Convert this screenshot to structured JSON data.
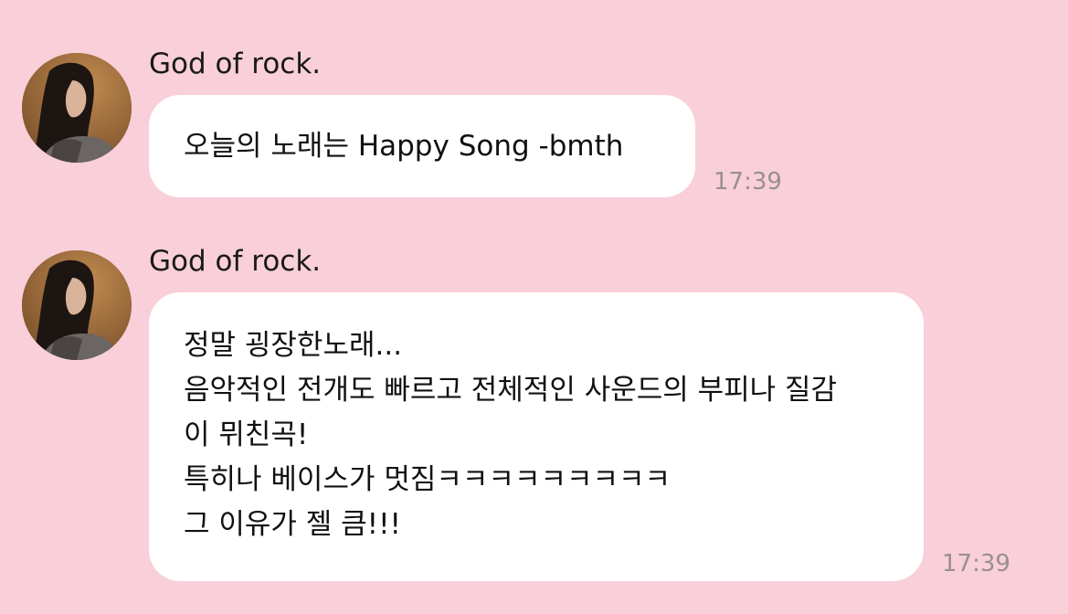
{
  "colors": {
    "background": "#f9cfd9",
    "bubble": "#ffffff",
    "text": "#111111",
    "timestamp": "#9a8f92"
  },
  "messages": [
    {
      "sender": "God of rock.",
      "avatar_icon": "profile-photo",
      "lines": [
        "오늘의 노래는 Happy Song -bmth"
      ],
      "time": "17:39"
    },
    {
      "sender": "God of rock.",
      "avatar_icon": "profile-photo",
      "lines": [
        "정말 굉장한노래...",
        "음악적인 전개도 빠르고 전체적인 사운드의 부피나 질감",
        "이 뮈친곡!",
        "특히나 베이스가 멋짐ㅋㅋㅋㅋㅋㅋㅋㅋㅋ",
        "그 이유가 젤 큼!!!"
      ],
      "time": "17:39"
    }
  ]
}
